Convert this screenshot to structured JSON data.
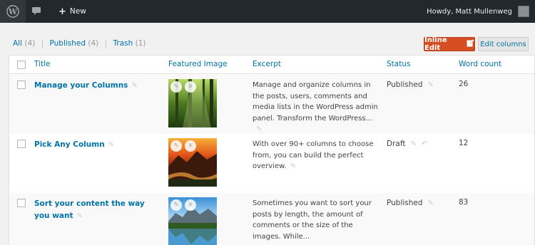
{
  "admin_bar": {
    "logo_icon": "wordpress-logo-icon",
    "comments_icon": "comment-bubble-icon",
    "new_label": "New",
    "howdy": "Howdy, Matt Mullenweg"
  },
  "filters": {
    "all_label": "All",
    "all_count": "(4)",
    "published_label": "Published",
    "published_count": "(4)",
    "trash_label": "Trash",
    "trash_count": "(1)"
  },
  "buttons": {
    "inline_edit": "Inline Edit",
    "edit_columns": "Edit columns"
  },
  "colors": {
    "accent": "#0073aa",
    "inline_edit_bg": "#d54e21",
    "admin_bar_bg": "#23282d"
  },
  "columns": [
    "Title",
    "Featured Image",
    "Excerpt",
    "Status",
    "Word count"
  ],
  "rows": [
    {
      "title": "Manage your Columns",
      "image": "forest-sunlight",
      "excerpt": "Manage and organize columns in the posts, users, comments and media lists in the WordPress admin panel. Transform the WordPress...",
      "status": "Published",
      "word_count": "26"
    },
    {
      "title": "Pick Any Column",
      "image": "sunset-mountains",
      "excerpt": "With over 90+ columns to choose from, you can build the perfect overview.",
      "status": "Draft",
      "word_count": "12"
    },
    {
      "title": "Sort your content the way you want",
      "image": "mountain-lake",
      "excerpt": "Sometimes you want to sort your posts by length, the amount of comments or the size of the images. While...",
      "status": "Published",
      "word_count": "83"
    }
  ]
}
